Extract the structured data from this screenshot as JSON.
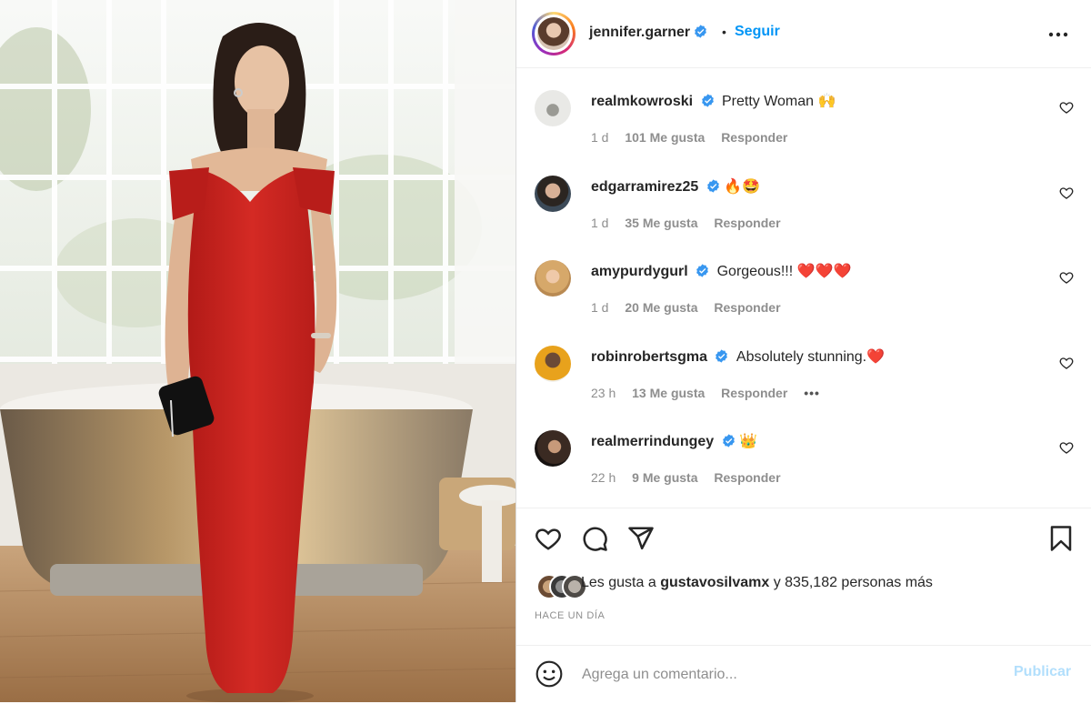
{
  "post": {
    "image_alt": "Mujer con vestido rojo largo junto a una bañera"
  },
  "header": {
    "username": "jennifer.garner",
    "separator": "•",
    "follow_label": "Seguir"
  },
  "comments": [
    {
      "username": "realmkowroski",
      "text": "Pretty Woman",
      "emoji": "🙌",
      "time": "1 d",
      "likes": "101 Me gusta",
      "reply": "Responder",
      "more": ""
    },
    {
      "username": "edgarramirez25",
      "text": "",
      "emoji": "🔥🤩",
      "time": "1 d",
      "likes": "35 Me gusta",
      "reply": "Responder",
      "more": ""
    },
    {
      "username": "amypurdygurl",
      "text": "Gorgeous!!!",
      "emoji": "❤️❤️❤️",
      "time": "1 d",
      "likes": "20 Me gusta",
      "reply": "Responder",
      "more": ""
    },
    {
      "username": "robinrobertsgma",
      "text": "Absolutely stunning.",
      "emoji": "❤️",
      "time": "23 h",
      "likes": "13 Me gusta",
      "reply": "Responder",
      "more": "•••"
    },
    {
      "username": "realmerrindungey",
      "text": "",
      "emoji": "👑",
      "time": "22 h",
      "likes": "9 Me gusta",
      "reply": "Responder",
      "more": ""
    }
  ],
  "likes": {
    "prefix": "Les gusta a",
    "user": "gustavosilvamx",
    "suffix": "y 835,182 personas más"
  },
  "timestamp": "HACE UN DÍA",
  "composer": {
    "placeholder": "Agrega un comentario...",
    "publish_label": "Publicar"
  },
  "colors": {
    "accent": "#0095f6",
    "verified": "#3897f0",
    "publish_disabled": "#b2dffc",
    "dress": "#c8201e"
  },
  "icons": [
    "heart-icon",
    "comment-icon",
    "share-icon",
    "bookmark-icon",
    "emoji-icon",
    "more-icon",
    "verified-icon"
  ]
}
